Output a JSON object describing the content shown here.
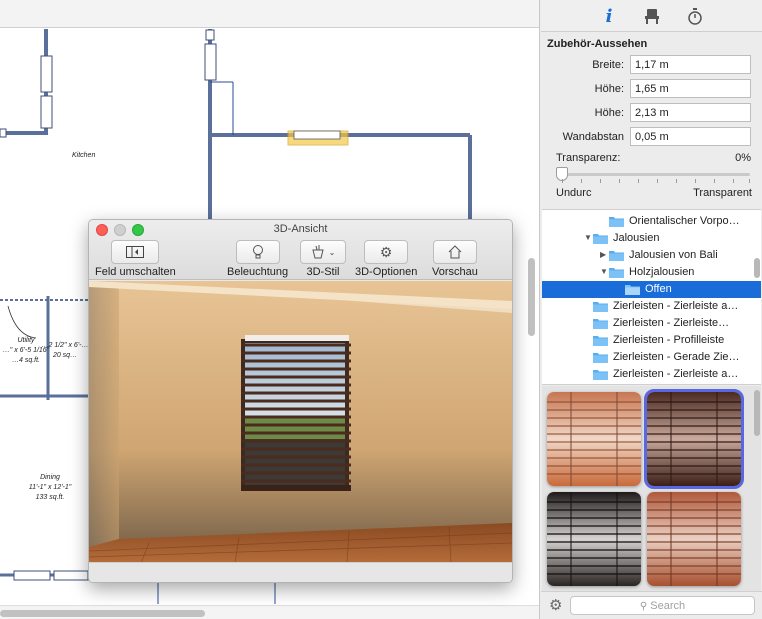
{
  "plan": {
    "rooms": [
      {
        "name": "Kitchen",
        "dims": "",
        "area": ""
      },
      {
        "name": "Utility",
        "dims": "…\" x 6'-5 1/16\"",
        "area": "…4 sq.ft."
      },
      {
        "name": "",
        "dims": "…2 1/2\" x 6'-…",
        "area": "20 sq…"
      },
      {
        "name": "Dining",
        "dims": "11'-1\" x 12'-1\"",
        "area": "133 sq.ft."
      }
    ]
  },
  "window3d": {
    "title": "3D-Ansicht",
    "toolbar": {
      "toggle_label": "Feld umschalten",
      "lighting_label": "Beleuchtung",
      "style_label": "3D-Stil",
      "options_label": "3D-Optionen",
      "preview_label": "Vorschau"
    }
  },
  "panel": {
    "tabs": [
      {
        "name": "info",
        "icon": "info-icon"
      },
      {
        "name": "furniture",
        "icon": "chair-icon"
      },
      {
        "name": "timer",
        "icon": "stopwatch-icon"
      }
    ],
    "section_title": "Zubehör-Aussehen",
    "properties": [
      {
        "label": "Breite:",
        "value": "1,17 m"
      },
      {
        "label": "Höhe:",
        "value": "1,65 m"
      },
      {
        "label": "Höhe:",
        "value": "2,13 m"
      },
      {
        "label": "Wandabstan",
        "value": "0,05 m"
      }
    ],
    "transparency": {
      "label": "Transparenz:",
      "value": "0%",
      "level": 0,
      "min_label": "Undurc",
      "max_label": "Transparent"
    },
    "tree": [
      {
        "label": "Orientalischer Vorpo…",
        "disclosure": "",
        "selected": false
      },
      {
        "label": "Jalousien",
        "disclosure": "open",
        "selected": false
      },
      {
        "label": "Jalousien von Bali",
        "disclosure": "closed",
        "selected": false
      },
      {
        "label": "Holzjalousien",
        "disclosure": "open",
        "selected": false
      },
      {
        "label": "Offen",
        "disclosure": "",
        "selected": true
      },
      {
        "label": "Zierleisten - Zierleiste a…",
        "disclosure": "",
        "selected": false
      },
      {
        "label": "Zierleisten - Zierleiste…",
        "disclosure": "",
        "selected": false
      },
      {
        "label": "Zierleisten - Profilleiste",
        "disclosure": "",
        "selected": false
      },
      {
        "label": "Zierleisten - Gerade Zie…",
        "disclosure": "",
        "selected": false
      },
      {
        "label": "Zierleisten - Zierleiste a…",
        "disclosure": "",
        "selected": false
      }
    ],
    "swatches": [
      {
        "name": "light-wood-blinds",
        "color": "#c8714f",
        "selected": false
      },
      {
        "name": "dark-wood-blinds",
        "color": "#5a3327",
        "selected": true
      },
      {
        "name": "black-blinds",
        "color": "#2b2624",
        "selected": false
      },
      {
        "name": "cherry-wood-blinds",
        "color": "#b8654a",
        "selected": false
      }
    ],
    "search_placeholder": "Search",
    "accent_color": "#1a6cd9"
  }
}
